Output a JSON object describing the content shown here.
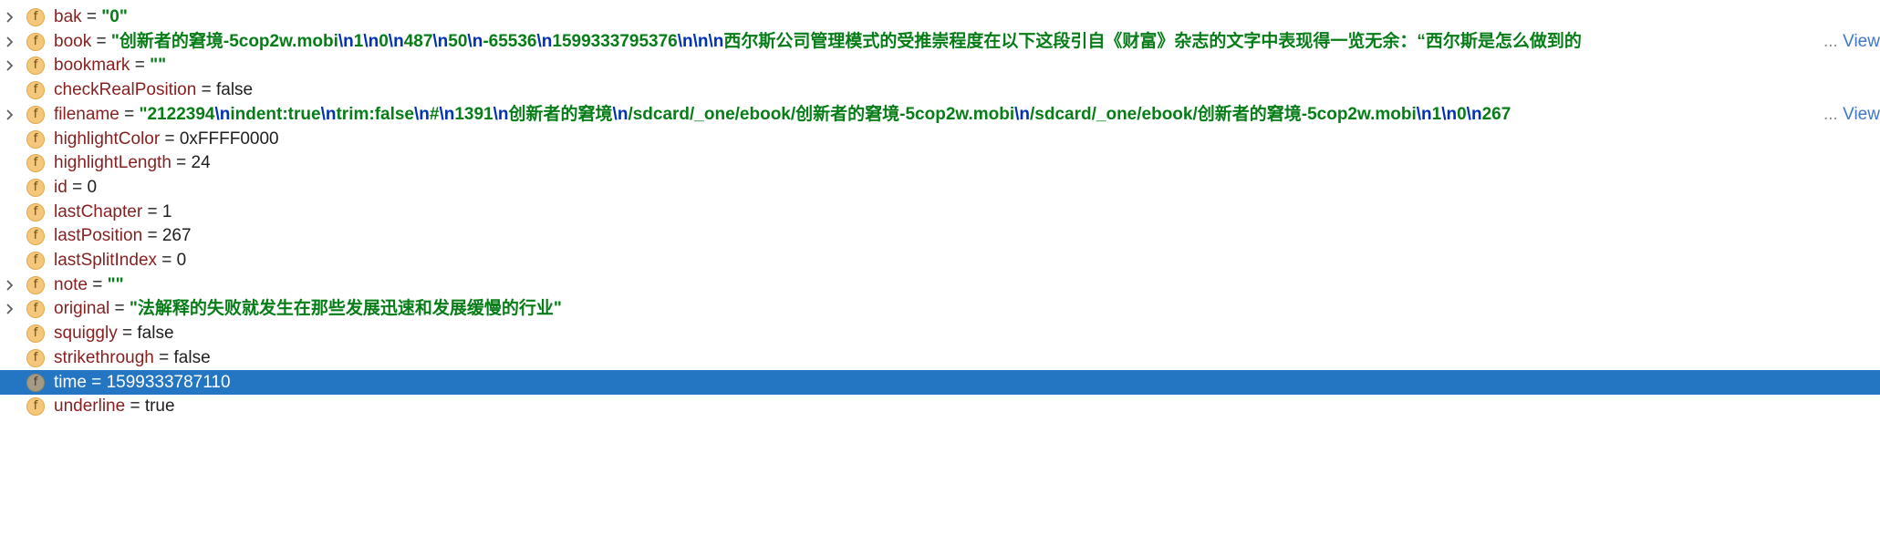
{
  "variables": [
    {
      "name": "bak",
      "expandable": true,
      "selected": false,
      "value": [
        {
          "t": "str",
          "v": "\"0\""
        }
      ]
    },
    {
      "name": "book",
      "expandable": true,
      "selected": false,
      "truncated": true,
      "value": [
        {
          "t": "str",
          "v": "\"创新者的窘境-5cop2w.mobi"
        },
        {
          "t": "esc",
          "v": "\\n"
        },
        {
          "t": "str",
          "v": "1"
        },
        {
          "t": "esc",
          "v": "\\n"
        },
        {
          "t": "str",
          "v": "0"
        },
        {
          "t": "esc",
          "v": "\\n"
        },
        {
          "t": "str",
          "v": "487"
        },
        {
          "t": "esc",
          "v": "\\n"
        },
        {
          "t": "str",
          "v": "50"
        },
        {
          "t": "esc",
          "v": "\\n"
        },
        {
          "t": "str",
          "v": "-65536"
        },
        {
          "t": "esc",
          "v": "\\n"
        },
        {
          "t": "str",
          "v": "1599333795376"
        },
        {
          "t": "esc",
          "v": "\\n\\n\\n"
        },
        {
          "t": "str",
          "v": "西尔斯公司管理模式的受推崇程度在以下这段引自《财富》杂志的文字中表现得一览无余：“西尔斯是怎么做到的"
        }
      ]
    },
    {
      "name": "bookmark",
      "expandable": true,
      "selected": false,
      "value": [
        {
          "t": "str",
          "v": "\"\""
        }
      ]
    },
    {
      "name": "checkRealPosition",
      "expandable": false,
      "selected": false,
      "value": [
        {
          "t": "plain",
          "v": "false"
        }
      ]
    },
    {
      "name": "filename",
      "expandable": true,
      "selected": false,
      "truncated": true,
      "value": [
        {
          "t": "str",
          "v": "\"2122394"
        },
        {
          "t": "esc",
          "v": "\\n"
        },
        {
          "t": "str",
          "v": "indent:true"
        },
        {
          "t": "esc",
          "v": "\\n"
        },
        {
          "t": "str",
          "v": "trim:false"
        },
        {
          "t": "esc",
          "v": "\\n"
        },
        {
          "t": "str",
          "v": "#"
        },
        {
          "t": "esc",
          "v": "\\n"
        },
        {
          "t": "str",
          "v": "1391"
        },
        {
          "t": "esc",
          "v": "\\n"
        },
        {
          "t": "str",
          "v": "创新者的窘境"
        },
        {
          "t": "esc",
          "v": "\\n"
        },
        {
          "t": "str",
          "v": "/sdcard/_one/ebook/创新者的窘境-5cop2w.mobi"
        },
        {
          "t": "esc",
          "v": "\\n"
        },
        {
          "t": "str",
          "v": "/sdcard/_one/ebook/创新者的窘境-5cop2w.mobi"
        },
        {
          "t": "esc",
          "v": "\\n"
        },
        {
          "t": "str",
          "v": "1"
        },
        {
          "t": "esc",
          "v": "\\n"
        },
        {
          "t": "str",
          "v": "0"
        },
        {
          "t": "esc",
          "v": "\\n"
        },
        {
          "t": "str",
          "v": "267"
        }
      ]
    },
    {
      "name": "highlightColor",
      "expandable": false,
      "selected": false,
      "value": [
        {
          "t": "plain",
          "v": "0xFFFF0000"
        }
      ]
    },
    {
      "name": "highlightLength",
      "expandable": false,
      "selected": false,
      "value": [
        {
          "t": "plain",
          "v": "24"
        }
      ]
    },
    {
      "name": "id",
      "expandable": false,
      "selected": false,
      "value": [
        {
          "t": "plain",
          "v": "0"
        }
      ]
    },
    {
      "name": "lastChapter",
      "expandable": false,
      "selected": false,
      "value": [
        {
          "t": "plain",
          "v": "1"
        }
      ]
    },
    {
      "name": "lastPosition",
      "expandable": false,
      "selected": false,
      "value": [
        {
          "t": "plain",
          "v": "267"
        }
      ]
    },
    {
      "name": "lastSplitIndex",
      "expandable": false,
      "selected": false,
      "value": [
        {
          "t": "plain",
          "v": "0"
        }
      ]
    },
    {
      "name": "note",
      "expandable": true,
      "selected": false,
      "value": [
        {
          "t": "str",
          "v": "\"\""
        }
      ]
    },
    {
      "name": "original",
      "expandable": true,
      "selected": false,
      "value": [
        {
          "t": "str",
          "v": "\"法解释的失败就发生在那些发展迅速和发展缓慢的行业\""
        }
      ]
    },
    {
      "name": "squiggly",
      "expandable": false,
      "selected": false,
      "value": [
        {
          "t": "plain",
          "v": "false"
        }
      ]
    },
    {
      "name": "strikethrough",
      "expandable": false,
      "selected": false,
      "value": [
        {
          "t": "plain",
          "v": "false"
        }
      ]
    },
    {
      "name": "time",
      "expandable": false,
      "selected": true,
      "value": [
        {
          "t": "plain",
          "v": "1599333787110"
        }
      ]
    },
    {
      "name": "underline",
      "expandable": false,
      "selected": false,
      "value": [
        {
          "t": "plain",
          "v": "true"
        }
      ]
    }
  ],
  "labels": {
    "field_icon": "f",
    "equals": " = ",
    "ellipsis": "...",
    "view": "View"
  },
  "colors": {
    "selection": "#2475c2",
    "field_name": "#871f1f",
    "string_value": "#067d17",
    "escape_sequence": "#0033b3",
    "link": "#3d78c7"
  }
}
